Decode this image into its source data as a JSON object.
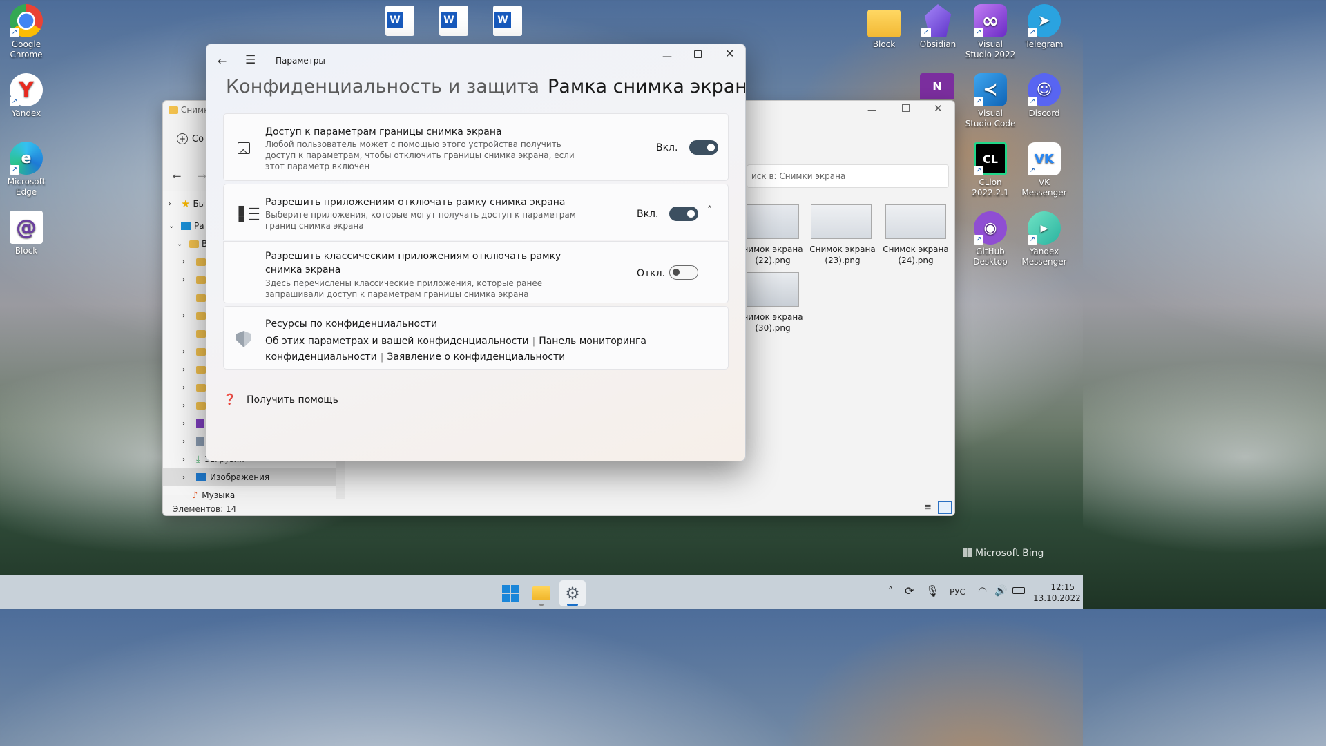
{
  "desktop": {
    "left_icons": [
      {
        "label": "Google Chrome",
        "icon": "chrome-icon"
      },
      {
        "label": "Yandex",
        "icon": "yandex-icon"
      },
      {
        "label": "Microsoft Edge",
        "icon": "edge-icon"
      },
      {
        "label": "Block",
        "icon": "block-app-icon"
      }
    ],
    "right_icons": [
      {
        "label": "Block",
        "icon": "folder-icon"
      },
      {
        "label": "Obsidian",
        "icon": "obsidian-icon"
      },
      {
        "label": "Visual Studio 2022",
        "icon": "visual-studio-icon"
      },
      {
        "label": "Telegram",
        "icon": "telegram-icon"
      },
      {
        "label": "Visual Studio Code",
        "icon": "vscode-icon"
      },
      {
        "label": "Discord",
        "icon": "discord-icon"
      },
      {
        "label": "CLion 2022.2.1",
        "icon": "clion-icon"
      },
      {
        "label": "VK Messenger",
        "icon": "vk-icon"
      },
      {
        "label": "GitHub Desktop",
        "icon": "github-icon"
      },
      {
        "label": "Yandex Messenger",
        "icon": "yandex-messenger-icon"
      }
    ],
    "bing_watermark": "Microsoft Bing"
  },
  "explorer": {
    "title": "Снимк",
    "new_button": "Со",
    "search_placeholder": "иск в: Снимки экрана",
    "nav_items": [
      "Бы",
      "Ра",
      "В",
      "Загрузки",
      "Изображения",
      "Музыка"
    ],
    "files": [
      "нимок экрана (22).png",
      "Снимок экрана (23).png",
      "Снимок экрана (24).png",
      "нимок экрана (30).png"
    ],
    "status": "Элементов: 14"
  },
  "settings": {
    "app_title": "Параметры",
    "breadcrumb_parent": "Конфиденциальность и защита",
    "breadcrumb_sep": "›",
    "page_title": "Рамка снимка экрана",
    "cards": [
      {
        "title": "Доступ к параметрам границы снимка экрана",
        "desc": "Любой пользователь может с помощью этого устройства получить доступ к параметрам, чтобы отключить границы снимка экрана, если этот параметр включен",
        "state": "Вкл.",
        "on": true
      },
      {
        "title": "Разрешить приложениям отключать рамку снимка экрана",
        "desc": "Выберите приложения, которые могут получать доступ к параметрам границ снимка экрана",
        "state": "Вкл.",
        "on": true
      },
      {
        "title": "Разрешить классическим приложениям отключать рамку снимка экрана",
        "desc": "Здесь перечислены классические приложения, которые ранее запрашивали доступ к параметрам границы снимка экрана",
        "state": "Откл.",
        "on": false
      }
    ],
    "resources": {
      "title": "Ресурсы по конфиденциальности",
      "link1": "Об этих параметрах и вашей конфиденциальности",
      "link2": "Панель мониторинга конфиденциальности",
      "link3": "Заявление о конфиденциальности"
    },
    "help": "Получить помощь"
  },
  "taskbar": {
    "language": "РУС",
    "time": "12:15",
    "date": "13.10.2022"
  }
}
